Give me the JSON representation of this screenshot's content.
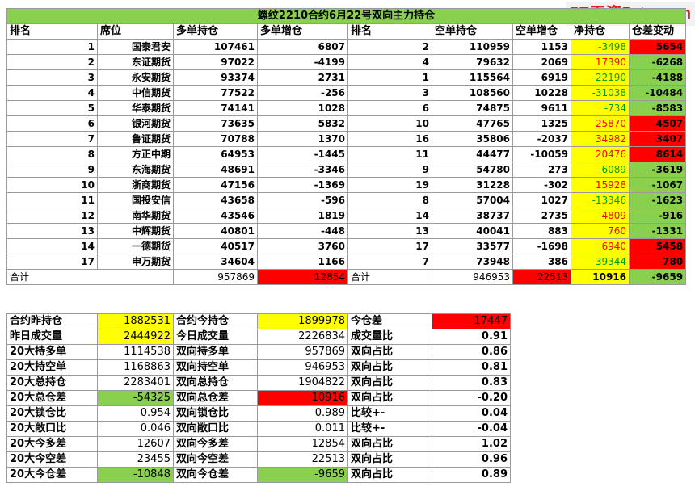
{
  "watermark": "5E天资5etz.com",
  "title": "螺纹2210合约6月22号双向主力持仓",
  "headers": [
    "排名",
    "席位",
    "多单持仓",
    "多单增仓",
    "排名",
    "空单持仓",
    "空单增仓",
    "净持仓",
    "仓差变动"
  ],
  "rows": [
    {
      "rank_long": "1",
      "seat": "国泰君安",
      "long_pos": "107461",
      "long_chg": "6807",
      "rank_short": "2",
      "short_pos": "110959",
      "short_chg": "1153",
      "net": "-3498",
      "diff": "5654"
    },
    {
      "rank_long": "2",
      "seat": "东证期货",
      "long_pos": "97022",
      "long_chg": "-4199",
      "rank_short": "4",
      "short_pos": "79632",
      "short_chg": "2069",
      "net": "17390",
      "diff": "-6268"
    },
    {
      "rank_long": "3",
      "seat": "永安期货",
      "long_pos": "93374",
      "long_chg": "2731",
      "rank_short": "1",
      "short_pos": "115564",
      "short_chg": "6919",
      "net": "-22190",
      "diff": "-4188"
    },
    {
      "rank_long": "4",
      "seat": "中信期货",
      "long_pos": "77522",
      "long_chg": "-256",
      "rank_short": "3",
      "short_pos": "108560",
      "short_chg": "10228",
      "net": "-31038",
      "diff": "-10484"
    },
    {
      "rank_long": "5",
      "seat": "华泰期货",
      "long_pos": "74141",
      "long_chg": "1028",
      "rank_short": "6",
      "short_pos": "74875",
      "short_chg": "9611",
      "net": "-734",
      "diff": "-8583"
    },
    {
      "rank_long": "6",
      "seat": "银河期货",
      "long_pos": "73635",
      "long_chg": "5832",
      "rank_short": "10",
      "short_pos": "47765",
      "short_chg": "1325",
      "net": "25870",
      "diff": "4507"
    },
    {
      "rank_long": "7",
      "seat": "鲁证期货",
      "long_pos": "70788",
      "long_chg": "1370",
      "rank_short": "16",
      "short_pos": "35806",
      "short_chg": "-2037",
      "net": "34982",
      "diff": "3407"
    },
    {
      "rank_long": "8",
      "seat": "方正中期",
      "long_pos": "64953",
      "long_chg": "-1445",
      "rank_short": "11",
      "short_pos": "44477",
      "short_chg": "-10059",
      "net": "20476",
      "diff": "8614"
    },
    {
      "rank_long": "9",
      "seat": "东海期货",
      "long_pos": "48691",
      "long_chg": "-3346",
      "rank_short": "9",
      "short_pos": "54780",
      "short_chg": "273",
      "net": "-6089",
      "diff": "-3619"
    },
    {
      "rank_long": "10",
      "seat": "浙商期货",
      "long_pos": "47156",
      "long_chg": "-1369",
      "rank_short": "19",
      "short_pos": "31228",
      "short_chg": "-302",
      "net": "15928",
      "diff": "-1067"
    },
    {
      "rank_long": "11",
      "seat": "国投安信",
      "long_pos": "43658",
      "long_chg": "-596",
      "rank_short": "8",
      "short_pos": "57004",
      "short_chg": "1027",
      "net": "-13346",
      "diff": "-1623"
    },
    {
      "rank_long": "12",
      "seat": "南华期货",
      "long_pos": "43546",
      "long_chg": "1819",
      "rank_short": "14",
      "short_pos": "38737",
      "short_chg": "2735",
      "net": "4809",
      "diff": "-916"
    },
    {
      "rank_long": "13",
      "seat": "中辉期货",
      "long_pos": "40801",
      "long_chg": "-448",
      "rank_short": "13",
      "short_pos": "40041",
      "short_chg": "883",
      "net": "760",
      "diff": "-1331"
    },
    {
      "rank_long": "14",
      "seat": "一德期货",
      "long_pos": "40517",
      "long_chg": "3760",
      "rank_short": "17",
      "short_pos": "33577",
      "short_chg": "-1698",
      "net": "6940",
      "diff": "5458"
    },
    {
      "rank_long": "17",
      "seat": "申万期货",
      "long_pos": "34604",
      "long_chg": "1166",
      "rank_short": "7",
      "short_pos": "73948",
      "short_chg": "386",
      "net": "-39344",
      "diff": "780"
    }
  ],
  "total": {
    "label": "合计",
    "long_pos": "957869",
    "long_chg": "12854",
    "label2": "合计",
    "short_pos": "946953",
    "short_chg": "22513",
    "net": "10916",
    "diff": "-9659"
  },
  "stats": [
    {
      "l1": "合约昨持仓",
      "v1": "1882531",
      "l2": "合约今持仓",
      "v2": "1899978",
      "l3": "今仓差",
      "v3": "17447"
    },
    {
      "l1": "昨日成交量",
      "v1": "2444922",
      "l2": "今日成交量",
      "v2": "2226834",
      "l3": "成交量比",
      "v3": "0.91"
    },
    {
      "l1": "20大持多单",
      "v1": "1114538",
      "l2": "双向持多单",
      "v2": "957869",
      "l3": "双向占比",
      "v3": "0.86"
    },
    {
      "l1": "20大持空单",
      "v1": "1168863",
      "l2": "双向持空单",
      "v2": "946953",
      "l3": "双向占比",
      "v3": "0.81"
    },
    {
      "l1": "20大总持仓",
      "v1": "2283401",
      "l2": "双向总持仓",
      "v2": "1904822",
      "l3": "双向占比",
      "v3": "0.83"
    },
    {
      "l1": "20大总仓差",
      "v1": "-54325",
      "l2": "双向总仓差",
      "v2": "10916",
      "l3": "双向占比",
      "v3": "-0.20"
    },
    {
      "l1": "20大锁仓比",
      "v1": "0.954",
      "l2": "双向锁仓比",
      "v2": "0.989",
      "l3": "比较+-",
      "v3": "0.04"
    },
    {
      "l1": "20大敞口比",
      "v1": "0.046",
      "l2": "双向敞口比",
      "v2": "0.011",
      "l3": "比较+-",
      "v3": "-0.04"
    },
    {
      "l1": "20大今多差",
      "v1": "12607",
      "l2": "双向今多差",
      "v2": "12854",
      "l3": "双向占比",
      "v3": "1.02"
    },
    {
      "l1": "20大今空差",
      "v1": "23455",
      "l2": "双向今空差",
      "v2": "22513",
      "l3": "双向占比",
      "v3": "0.96"
    },
    {
      "l1": "20大今仓差",
      "v1": "-10848",
      "l2": "双向今仓差",
      "v2": "-9659",
      "l3": "双向占比",
      "v3": "0.89"
    }
  ],
  "colors": {
    "yellow": "#ffff00",
    "red": "#ff0000",
    "green": "#8ad04f",
    "neg_text": "#00a000",
    "pos_text": "#ff0000"
  }
}
